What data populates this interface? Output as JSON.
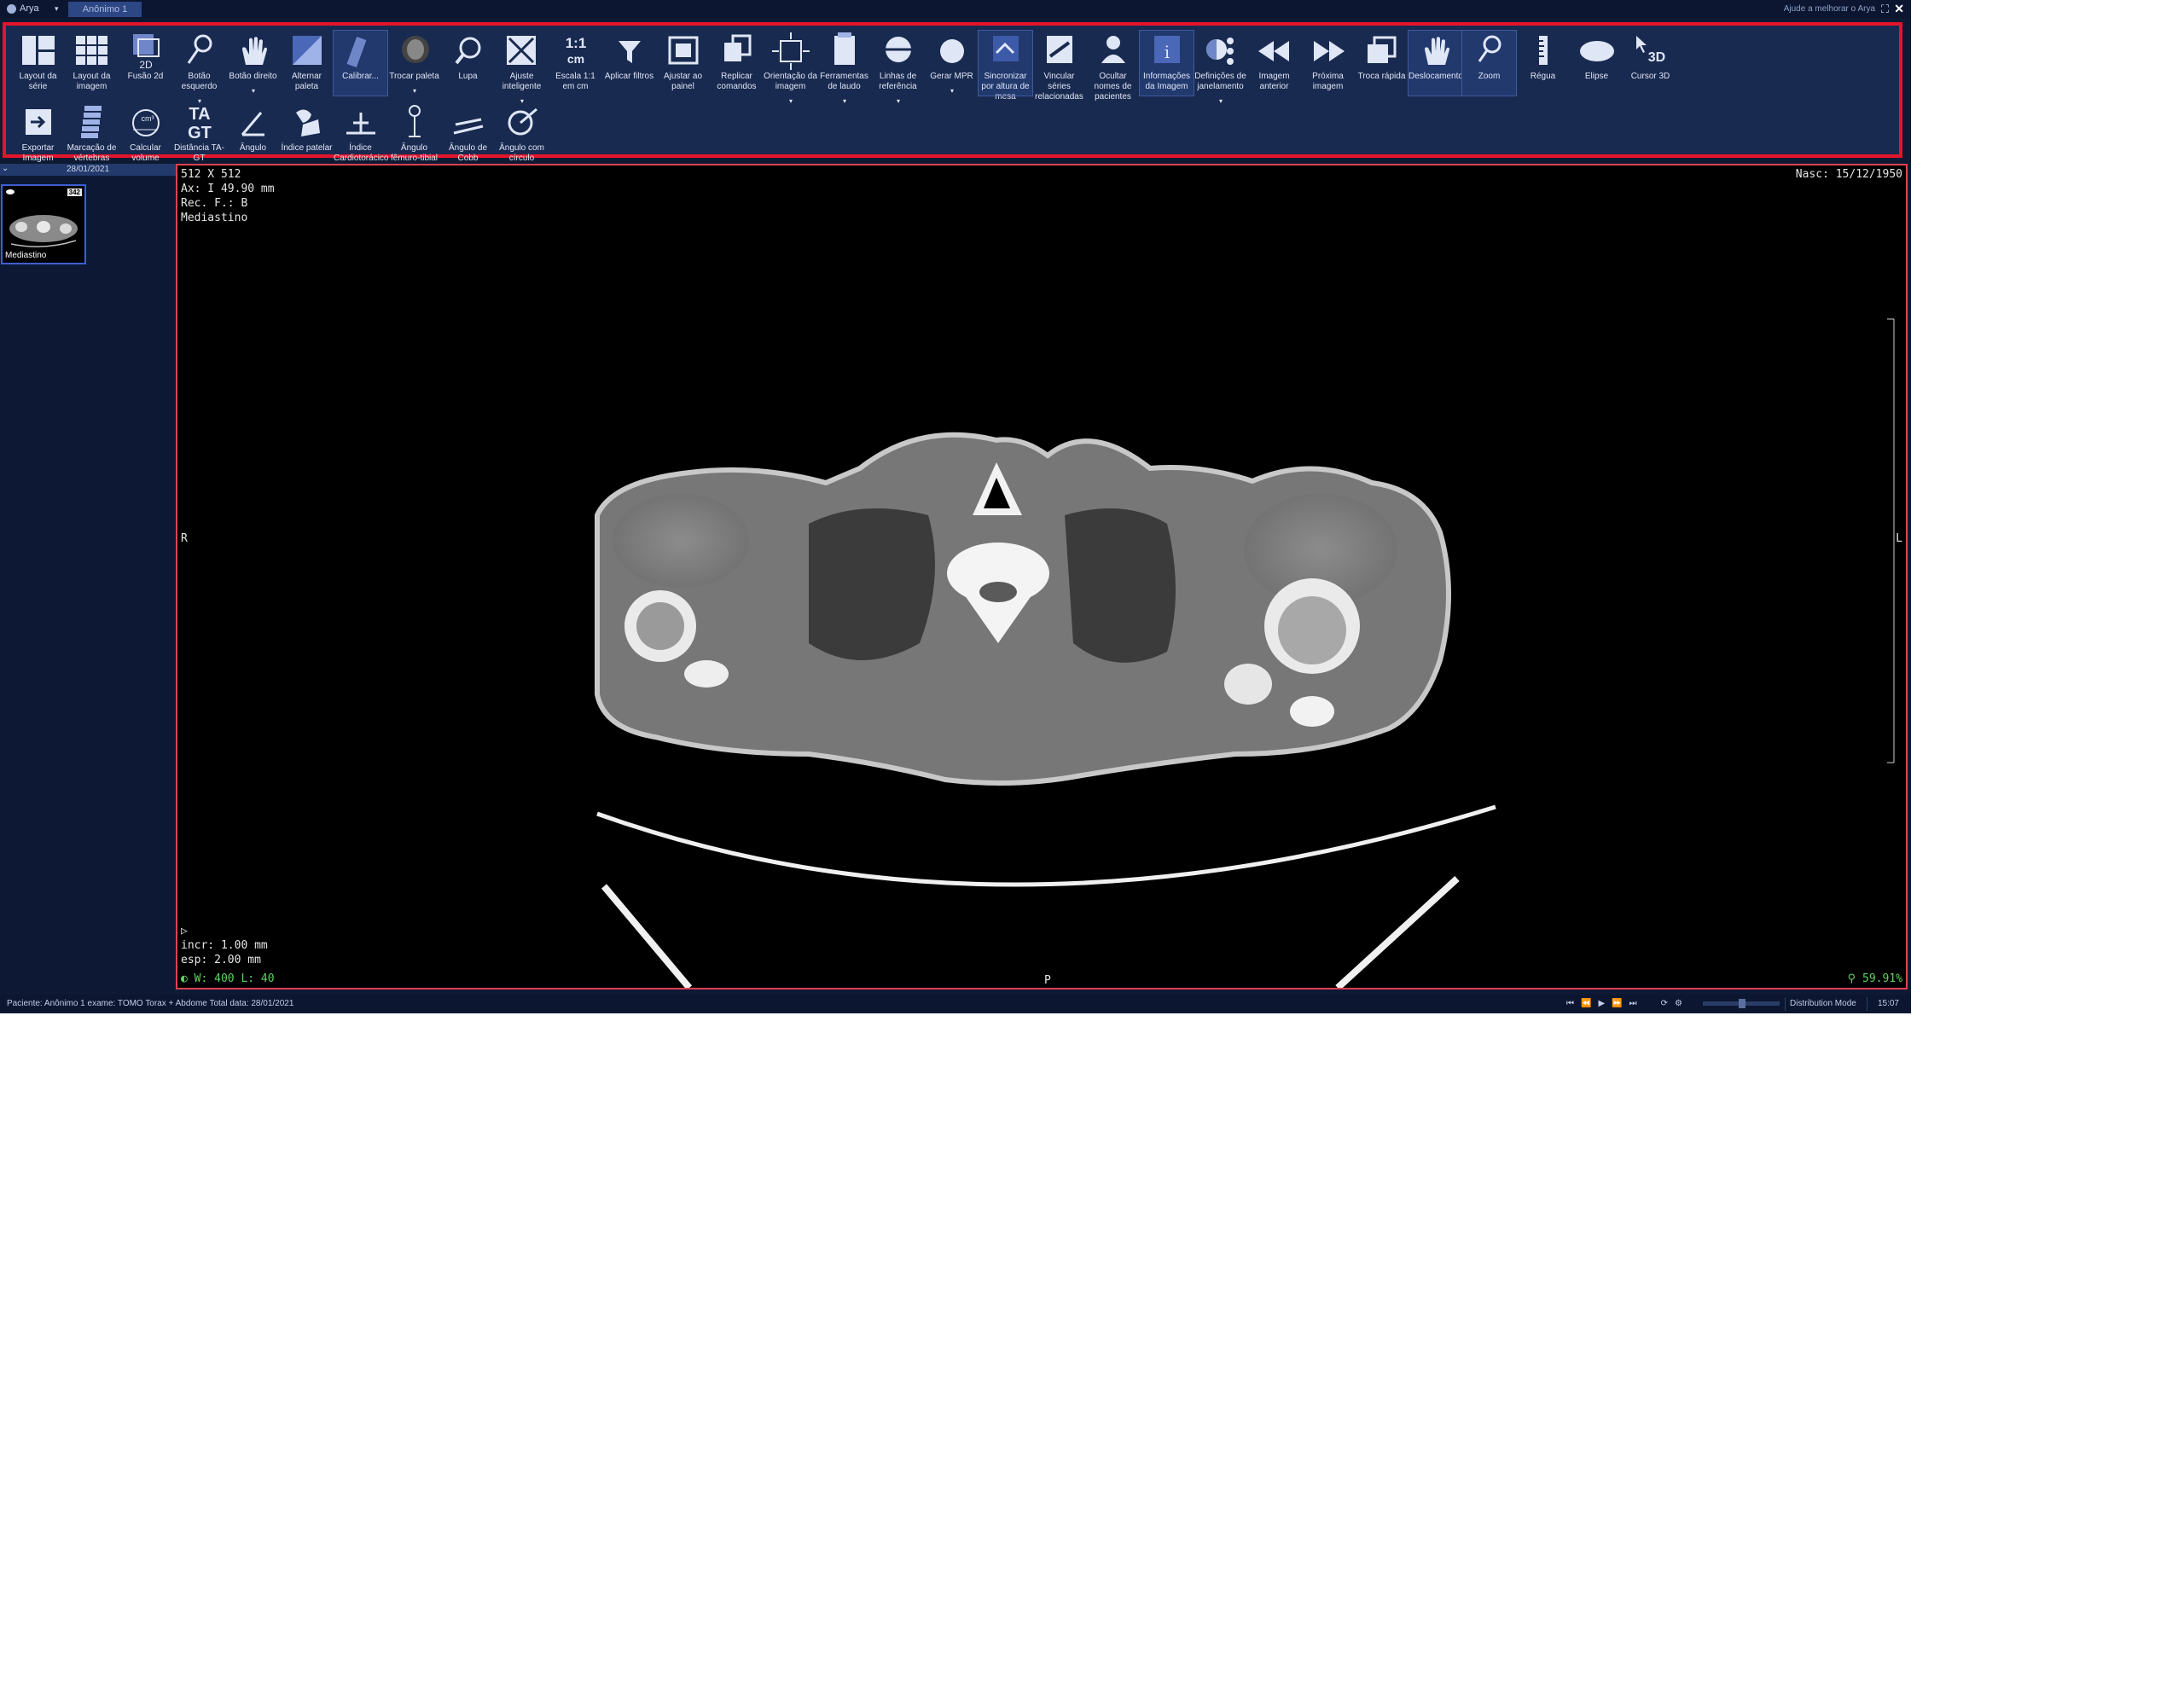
{
  "titlebar": {
    "app_name": "Arya",
    "tab": "Anônimo 1",
    "help_text": "Ajude a melhorar o Arya"
  },
  "toolbar": {
    "row1": [
      {
        "name": "layout-da-serie",
        "label": "Layout da série",
        "icon": "series-layout-icon"
      },
      {
        "name": "layout-da-imagem",
        "label": "Layout da imagem",
        "icon": "grid-layout-icon"
      },
      {
        "name": "fusao-2d",
        "label": "Fusão 2d",
        "icon": "fusion-2d-icon"
      },
      {
        "name": "botao-esquerdo",
        "label": "Botão esquerdo",
        "icon": "magnifier-icon",
        "dropdown": true
      },
      {
        "name": "botao-direito",
        "label": "Botão direito",
        "icon": "hand-icon",
        "dropdown": true
      },
      {
        "name": "alternar-paleta",
        "label": "Alternar paleta",
        "icon": "palette-icon"
      },
      {
        "name": "calibrar",
        "label": "Calibrar...",
        "icon": "ruler-calibrate-icon",
        "selected": true
      },
      {
        "name": "trocar-paleta",
        "label": "Trocar paleta",
        "icon": "head-scan-icon",
        "dropdown": true
      },
      {
        "name": "lupa",
        "label": "Lupa",
        "icon": "loupe-icon"
      },
      {
        "name": "ajuste-inteligente",
        "label": "Ajuste inteligente",
        "icon": "smart-fit-icon",
        "dropdown": true
      },
      {
        "name": "escala-1-1",
        "label": "Escala 1:1 em cm",
        "icon": "scale-1-1-icon"
      },
      {
        "name": "aplicar-filtros",
        "label": "Aplicar filtros",
        "icon": "filter-icon"
      },
      {
        "name": "ajustar-ao-painel",
        "label": "Ajustar ao painel",
        "icon": "fit-panel-icon"
      },
      {
        "name": "replicar-comandos",
        "label": "Replicar comandos",
        "icon": "replicate-icon"
      },
      {
        "name": "orientacao-da-imagem",
        "label": "Orientação da imagem",
        "icon": "orientation-icon",
        "dropdown": true
      },
      {
        "name": "ferramentas-de-laudo",
        "label": "Ferramentas de laudo",
        "icon": "report-icon",
        "dropdown": true
      },
      {
        "name": "linhas-de-referencia",
        "label": "Linhas de referência",
        "icon": "reference-lines-icon",
        "dropdown": true
      },
      {
        "name": "gerar-mpr",
        "label": "Gerar MPR",
        "icon": "mpr-sphere-icon",
        "dropdown": true
      },
      {
        "name": "sincronizar",
        "label": "Sincronizar por altura de mesa",
        "icon": "sync-icon",
        "selected": true
      },
      {
        "name": "vincular-series",
        "label": "Vincular séries relacionadas",
        "icon": "link-series-icon"
      },
      {
        "name": "ocultar-nomes",
        "label": "Ocultar nomes de pacientes",
        "icon": "hide-patient-icon"
      },
      {
        "name": "informacoes-imagem",
        "label": "Informações da Imagem",
        "icon": "info-icon",
        "selected": true
      },
      {
        "name": "definicoes-janelamento",
        "label": "Definições de janelamento",
        "icon": "windowing-icon",
        "dropdown": true
      },
      {
        "name": "imagem-anterior",
        "label": "Imagem anterior",
        "icon": "rewind-icon"
      },
      {
        "name": "proxima-imagem",
        "label": "Próxima imagem",
        "icon": "fast-forward-icon"
      },
      {
        "name": "troca-rapida",
        "label": "Troca rápida",
        "icon": "quick-swap-icon"
      },
      {
        "name": "deslocamento",
        "label": "Deslocamento",
        "icon": "pan-hand-icon",
        "selected": true
      },
      {
        "name": "zoom",
        "label": "Zoom",
        "icon": "zoom-icon",
        "selected": true
      },
      {
        "name": "regua",
        "label": "Régua",
        "icon": "ruler-icon"
      },
      {
        "name": "elipse",
        "label": "Elipse",
        "icon": "ellipse-icon"
      },
      {
        "name": "cursor-3d",
        "label": "Cursor 3D",
        "icon": "cursor-3d-icon"
      }
    ],
    "row2": [
      {
        "name": "exportar-imagem",
        "label": "Exportar Imagem",
        "icon": "export-icon"
      },
      {
        "name": "marcacao-vertebras",
        "label": "Marcação de vértebras",
        "icon": "spine-icon"
      },
      {
        "name": "calcular-volume",
        "label": "Calcular volume",
        "icon": "volume-icon"
      },
      {
        "name": "distancia-ta-gt",
        "label": "Distância TA-GT",
        "icon": "ta-gt-icon"
      },
      {
        "name": "angulo",
        "label": "Ângulo",
        "icon": "angle-icon"
      },
      {
        "name": "indice-patelar",
        "label": "Índice patelar",
        "icon": "patella-icon"
      },
      {
        "name": "indice-cardiotoracico",
        "label": "Índice Cardiotorácico",
        "icon": "cardiothoracic-icon"
      },
      {
        "name": "angulo-femuro-tibial",
        "label": "Ângulo fêmuro-tibial",
        "icon": "femur-tibia-icon"
      },
      {
        "name": "angulo-cobb",
        "label": "Ângulo de Cobb",
        "icon": "cobb-angle-icon"
      },
      {
        "name": "angulo-com-circulo",
        "label": "Ângulo com círculo",
        "icon": "angle-circle-icon"
      }
    ]
  },
  "leftpanel": {
    "date": "28/01/2021",
    "thumb_badge": "342",
    "thumb_label": "Mediastino"
  },
  "viewer": {
    "top_left": [
      "512 X 512",
      "Ax: I  49.90 mm",
      "Rec. F.: B",
      "Mediastino"
    ],
    "top_right": "Nasc: 15/12/1950",
    "bottom_left": [
      "incr: 1.00 mm",
      "esp: 2.00 mm"
    ],
    "window_level": "W: 400 L: 40",
    "zoom": "59.91%",
    "marker_left": "R",
    "marker_right": "L",
    "marker_bottom": "P"
  },
  "statusbar": {
    "patient_text": "Paciente: Anônimo 1 exame: TOMO Torax + Abdome Total data: 28/01/2021",
    "mode": "Distribution Mode",
    "time": "15:07"
  },
  "colors": {
    "app_bg": "#0e1a33",
    "toolbar_bg": "#192a50",
    "highlight_border": "#e6142a",
    "selected_tool": "#22396e",
    "wl_text": "#5fd25f"
  }
}
